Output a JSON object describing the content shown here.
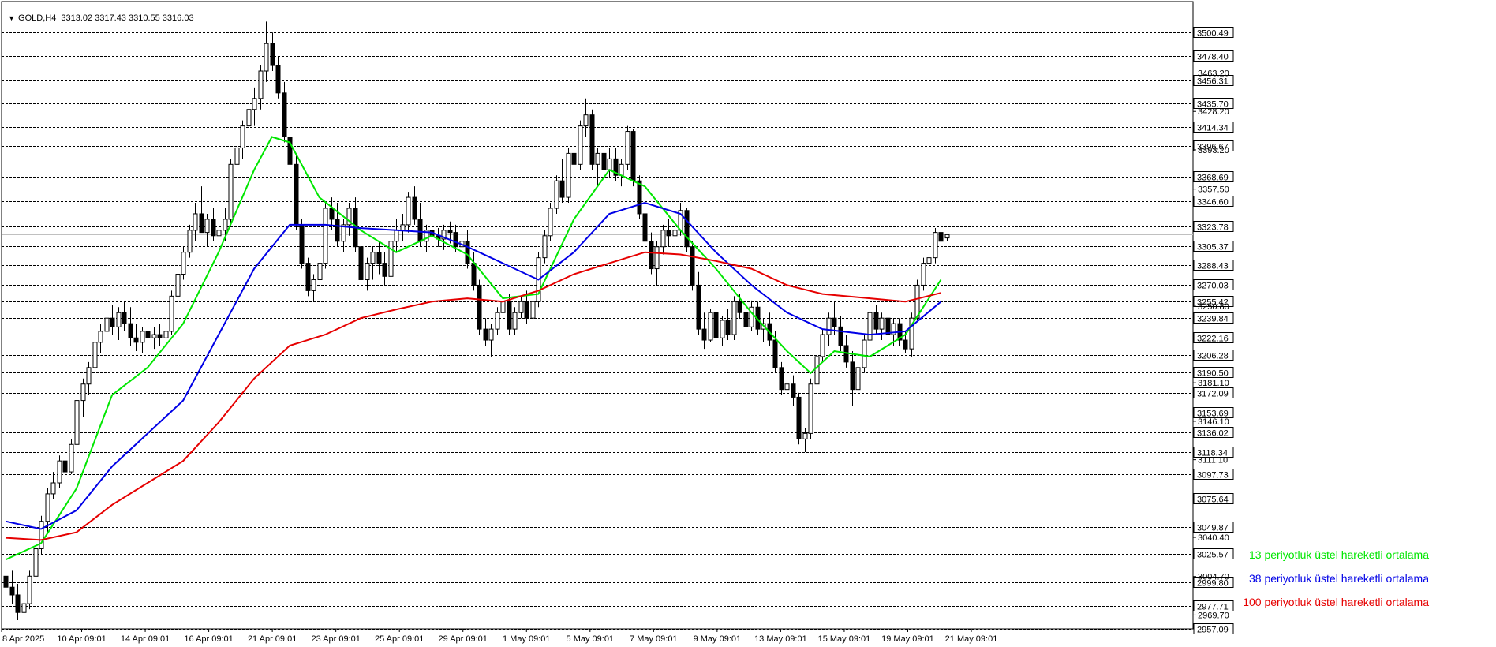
{
  "header": {
    "dropdown_icon": "triangle-down-icon",
    "symbol": "GOLD,H4",
    "ohlc": "3313.02 3317.43 3310.55 3316.03"
  },
  "legend": [
    {
      "label": "13 periyotluk üstel hareketli ortalama",
      "color": "#00e600"
    },
    {
      "label": "38 periyotluk üstel hareketli ortalama",
      "color": "#0000e6"
    },
    {
      "label": "100 periyotluk üstel hareketli ortalama",
      "color": "#e60000"
    }
  ],
  "chart_data": {
    "type": "candlestick",
    "symbol": "GOLD",
    "timeframe": "H4",
    "current_price": "3316.03",
    "ylim": [
      2957.09,
      3525
    ],
    "grid": "dashed horizontal",
    "x_labels": [
      "8 Apr 2025",
      "10 Apr 09:01",
      "14 Apr 09:01",
      "16 Apr 09:01",
      "21 Apr 09:01",
      "23 Apr 09:01",
      "25 Apr 09:01",
      "29 Apr 09:01",
      "1 May 09:01",
      "5 May 09:01",
      "7 May 09:01",
      "9 May 09:01",
      "13 May 09:01",
      "15 May 09:01",
      "19 May 09:01",
      "21 May 09:01"
    ],
    "y_labels_boxed": [
      "3500.49",
      "3478.40",
      "3456.31",
      "3435.70",
      "3414.34",
      "3396.67",
      "3368.69",
      "3346.60",
      "3323.78",
      "3305.37",
      "3288.43",
      "3270.03",
      "3255.42",
      "3239.84",
      "3222.16",
      "3206.28",
      "3190.50",
      "3172.09",
      "3153.69",
      "3136.02",
      "3118.34",
      "3097.73",
      "3075.64",
      "3049.87",
      "3025.57",
      "2999.80",
      "2977.71",
      "2957.09"
    ],
    "y_labels_plain": [
      "3463.20",
      "3428.20",
      "3393.20",
      "3357.50",
      "3323.78",
      "3288.43",
      "3250.80",
      "3222.16",
      "3181.10",
      "3146.10",
      "3111.10",
      "3075.64",
      "3040.40",
      "3004.70",
      "2969.70"
    ],
    "candles": [
      [
        3005,
        3012,
        2985,
        2995
      ],
      [
        2995,
        3010,
        2980,
        2988
      ],
      [
        2988,
        2998,
        2965,
        2972
      ],
      [
        2972,
        2985,
        2960,
        2980
      ],
      [
        2980,
        3010,
        2975,
        3005
      ],
      [
        3005,
        3035,
        3000,
        3030
      ],
      [
        3030,
        3060,
        3025,
        3055
      ],
      [
        3055,
        3085,
        3045,
        3080
      ],
      [
        3080,
        3100,
        3075,
        3090
      ],
      [
        3090,
        3115,
        3085,
        3110
      ],
      [
        3110,
        3125,
        3095,
        3100
      ],
      [
        3100,
        3130,
        3098,
        3125
      ],
      [
        3125,
        3170,
        3120,
        3165
      ],
      [
        3165,
        3185,
        3150,
        3180
      ],
      [
        3180,
        3200,
        3170,
        3195
      ],
      [
        3195,
        3222,
        3190,
        3218
      ],
      [
        3218,
        3235,
        3208,
        3228
      ],
      [
        3228,
        3248,
        3220,
        3240
      ],
      [
        3240,
        3252,
        3225,
        3232
      ],
      [
        3232,
        3250,
        3220,
        3245
      ],
      [
        3245,
        3255,
        3228,
        3235
      ],
      [
        3235,
        3250,
        3215,
        3222
      ],
      [
        3222,
        3235,
        3210,
        3218
      ],
      [
        3218,
        3232,
        3208,
        3228
      ],
      [
        3228,
        3240,
        3218,
        3222
      ],
      [
        3222,
        3232,
        3212,
        3225
      ],
      [
        3225,
        3235,
        3215,
        3222
      ],
      [
        3222,
        3238,
        3212,
        3228
      ],
      [
        3228,
        3265,
        3225,
        3260
      ],
      [
        3260,
        3285,
        3255,
        3280
      ],
      [
        3280,
        3305,
        3275,
        3300
      ],
      [
        3300,
        3325,
        3295,
        3320
      ],
      [
        3320,
        3345,
        3310,
        3335
      ],
      [
        3335,
        3360,
        3320,
        3318
      ],
      [
        3318,
        3335,
        3305,
        3330
      ],
      [
        3330,
        3340,
        3310,
        3315
      ],
      [
        3315,
        3330,
        3300,
        3320
      ],
      [
        3320,
        3340,
        3310,
        3330
      ],
      [
        3330,
        3385,
        3325,
        3380
      ],
      [
        3380,
        3400,
        3370,
        3395
      ],
      [
        3395,
        3420,
        3385,
        3415
      ],
      [
        3415,
        3435,
        3405,
        3430
      ],
      [
        3430,
        3450,
        3415,
        3440
      ],
      [
        3440,
        3470,
        3430,
        3465
      ],
      [
        3465,
        3510,
        3455,
        3490
      ],
      [
        3490,
        3500,
        3465,
        3470
      ],
      [
        3470,
        3478,
        3440,
        3445
      ],
      [
        3445,
        3455,
        3400,
        3405
      ],
      [
        3405,
        3410,
        3375,
        3380
      ],
      [
        3380,
        3390,
        3320,
        3325
      ],
      [
        3325,
        3330,
        3285,
        3290
      ],
      [
        3290,
        3295,
        3260,
        3265
      ],
      [
        3265,
        3280,
        3255,
        3275
      ],
      [
        3275,
        3295,
        3265,
        3290
      ],
      [
        3290,
        3345,
        3285,
        3340
      ],
      [
        3340,
        3350,
        3320,
        3330
      ],
      [
        3330,
        3345,
        3305,
        3310
      ],
      [
        3310,
        3330,
        3300,
        3325
      ],
      [
        3325,
        3345,
        3315,
        3340
      ],
      [
        3340,
        3350,
        3300,
        3305
      ],
      [
        3305,
        3315,
        3270,
        3275
      ],
      [
        3275,
        3295,
        3265,
        3290
      ],
      [
        3290,
        3305,
        3275,
        3300
      ],
      [
        3300,
        3310,
        3280,
        3290
      ],
      [
        3290,
        3300,
        3270,
        3278
      ],
      [
        3278,
        3315,
        3275,
        3310
      ],
      [
        3310,
        3330,
        3300,
        3320
      ],
      [
        3320,
        3335,
        3310,
        3325
      ],
      [
        3325,
        3355,
        3318,
        3350
      ],
      [
        3350,
        3360,
        3325,
        3330
      ],
      [
        3330,
        3345,
        3305,
        3310
      ],
      [
        3310,
        3325,
        3300,
        3320
      ],
      [
        3320,
        3330,
        3310,
        3315
      ],
      [
        3315,
        3322,
        3305,
        3312
      ],
      [
        3312,
        3325,
        3302,
        3320
      ],
      [
        3320,
        3328,
        3308,
        3318
      ],
      [
        3318,
        3325,
        3300,
        3305
      ],
      [
        3305,
        3318,
        3295,
        3310
      ],
      [
        3310,
        3320,
        3285,
        3290
      ],
      [
        3290,
        3300,
        3265,
        3270
      ],
      [
        3270,
        3275,
        3225,
        3230
      ],
      [
        3230,
        3240,
        3215,
        3220
      ],
      [
        3220,
        3235,
        3205,
        3230
      ],
      [
        3230,
        3250,
        3225,
        3245
      ],
      [
        3245,
        3260,
        3240,
        3255
      ],
      [
        3255,
        3262,
        3225,
        3230
      ],
      [
        3230,
        3250,
        3225,
        3245
      ],
      [
        3245,
        3260,
        3240,
        3255
      ],
      [
        3255,
        3265,
        3235,
        3240
      ],
      [
        3240,
        3260,
        3235,
        3255
      ],
      [
        3255,
        3300,
        3250,
        3295
      ],
      [
        3295,
        3320,
        3290,
        3315
      ],
      [
        3315,
        3345,
        3310,
        3340
      ],
      [
        3340,
        3370,
        3335,
        3365
      ],
      [
        3365,
        3385,
        3345,
        3350
      ],
      [
        3350,
        3395,
        3345,
        3390
      ],
      [
        3390,
        3400,
        3375,
        3380
      ],
      [
        3380,
        3420,
        3375,
        3415
      ],
      [
        3415,
        3440,
        3405,
        3425
      ],
      [
        3425,
        3430,
        3375,
        3380
      ],
      [
        3380,
        3395,
        3360,
        3390
      ],
      [
        3390,
        3400,
        3370,
        3375
      ],
      [
        3375,
        3395,
        3368,
        3385
      ],
      [
        3385,
        3395,
        3365,
        3370
      ],
      [
        3370,
        3385,
        3360,
        3380
      ],
      [
        3380,
        3415,
        3375,
        3410
      ],
      [
        3410,
        3412,
        3360,
        3365
      ],
      [
        3365,
        3370,
        3330,
        3335
      ],
      [
        3335,
        3345,
        3300,
        3310
      ],
      [
        3310,
        3318,
        3280,
        3285
      ],
      [
        3285,
        3310,
        3270,
        3305
      ],
      [
        3305,
        3325,
        3298,
        3320
      ],
      [
        3320,
        3330,
        3305,
        3315
      ],
      [
        3315,
        3325,
        3305,
        3320
      ],
      [
        3320,
        3345,
        3315,
        3338
      ],
      [
        3338,
        3340,
        3300,
        3305
      ],
      [
        3305,
        3310,
        3265,
        3270
      ],
      [
        3270,
        3282,
        3225,
        3230
      ],
      [
        3230,
        3245,
        3212,
        3220
      ],
      [
        3220,
        3248,
        3218,
        3245
      ],
      [
        3245,
        3250,
        3215,
        3222
      ],
      [
        3222,
        3242,
        3215,
        3238
      ],
      [
        3238,
        3248,
        3220,
        3225
      ],
      [
        3225,
        3260,
        3220,
        3255
      ],
      [
        3255,
        3262,
        3240,
        3245
      ],
      [
        3245,
        3252,
        3225,
        3232
      ],
      [
        3232,
        3256,
        3228,
        3250
      ],
      [
        3250,
        3255,
        3225,
        3230
      ],
      [
        3230,
        3240,
        3218,
        3235
      ],
      [
        3235,
        3245,
        3215,
        3220
      ],
      [
        3220,
        3228,
        3190,
        3195
      ],
      [
        3195,
        3200,
        3170,
        3175
      ],
      [
        3175,
        3185,
        3165,
        3180
      ],
      [
        3180,
        3188,
        3160,
        3168
      ],
      [
        3168,
        3172,
        3125,
        3130
      ],
      [
        3130,
        3140,
        3118,
        3135
      ],
      [
        3135,
        3185,
        3130,
        3180
      ],
      [
        3180,
        3210,
        3175,
        3205
      ],
      [
        3205,
        3230,
        3200,
        3225
      ],
      [
        3225,
        3245,
        3215,
        3240
      ],
      [
        3240,
        3255,
        3225,
        3232
      ],
      [
        3232,
        3242,
        3210,
        3215
      ],
      [
        3215,
        3225,
        3195,
        3200
      ],
      [
        3200,
        3210,
        3160,
        3175
      ],
      [
        3175,
        3200,
        3170,
        3195
      ],
      [
        3195,
        3225,
        3190,
        3220
      ],
      [
        3220,
        3250,
        3215,
        3245
      ],
      [
        3245,
        3252,
        3225,
        3230
      ],
      [
        3230,
        3245,
        3220,
        3240
      ],
      [
        3240,
        3248,
        3220,
        3225
      ],
      [
        3225,
        3240,
        3215,
        3235
      ],
      [
        3235,
        3240,
        3215,
        3220
      ],
      [
        3220,
        3228,
        3208,
        3212
      ],
      [
        3212,
        3245,
        3205,
        3240
      ],
      [
        3240,
        3275,
        3238,
        3270
      ],
      [
        3270,
        3295,
        3265,
        3290
      ],
      [
        3290,
        3300,
        3280,
        3295
      ],
      [
        3295,
        3322,
        3290,
        3318
      ],
      [
        3318,
        3325,
        3305,
        3310
      ],
      [
        3313,
        3317,
        3310,
        3316
      ]
    ],
    "series": [
      {
        "name": "13 periyotluk üstel hareketli ortalama",
        "color": "#00e600",
        "points": [
          [
            0,
            3020
          ],
          [
            6,
            3035
          ],
          [
            12,
            3085
          ],
          [
            18,
            3170
          ],
          [
            24,
            3195
          ],
          [
            30,
            3235
          ],
          [
            36,
            3300
          ],
          [
            42,
            3375
          ],
          [
            45,
            3405
          ],
          [
            48,
            3400
          ],
          [
            53,
            3350
          ],
          [
            60,
            3320
          ],
          [
            66,
            3300
          ],
          [
            72,
            3315
          ],
          [
            78,
            3298
          ],
          [
            84,
            3258
          ],
          [
            90,
            3262
          ],
          [
            96,
            3330
          ],
          [
            102,
            3375
          ],
          [
            108,
            3360
          ],
          [
            114,
            3320
          ],
          [
            120,
            3285
          ],
          [
            126,
            3245
          ],
          [
            132,
            3210
          ],
          [
            136,
            3190
          ],
          [
            140,
            3210
          ],
          [
            146,
            3205
          ],
          [
            152,
            3225
          ],
          [
            158,
            3275
          ]
        ]
      },
      {
        "name": "38 periyotluk üstel hareketli ortalama",
        "color": "#0000e6",
        "points": [
          [
            0,
            3055
          ],
          [
            6,
            3048
          ],
          [
            12,
            3065
          ],
          [
            18,
            3105
          ],
          [
            24,
            3135
          ],
          [
            30,
            3165
          ],
          [
            36,
            3225
          ],
          [
            42,
            3285
          ],
          [
            48,
            3325
          ],
          [
            54,
            3325
          ],
          [
            60,
            3322
          ],
          [
            66,
            3320
          ],
          [
            72,
            3318
          ],
          [
            78,
            3305
          ],
          [
            84,
            3290
          ],
          [
            90,
            3275
          ],
          [
            96,
            3300
          ],
          [
            102,
            3335
          ],
          [
            108,
            3345
          ],
          [
            114,
            3335
          ],
          [
            120,
            3300
          ],
          [
            126,
            3270
          ],
          [
            132,
            3245
          ],
          [
            138,
            3230
          ],
          [
            146,
            3225
          ],
          [
            152,
            3228
          ],
          [
            158,
            3255
          ]
        ]
      },
      {
        "name": "100 periyotluk üstel hareketli ortalama",
        "color": "#e60000",
        "points": [
          [
            0,
            3040
          ],
          [
            6,
            3038
          ],
          [
            12,
            3045
          ],
          [
            18,
            3070
          ],
          [
            24,
            3090
          ],
          [
            30,
            3110
          ],
          [
            36,
            3145
          ],
          [
            42,
            3185
          ],
          [
            48,
            3215
          ],
          [
            54,
            3225
          ],
          [
            60,
            3240
          ],
          [
            66,
            3248
          ],
          [
            72,
            3255
          ],
          [
            78,
            3258
          ],
          [
            84,
            3255
          ],
          [
            90,
            3265
          ],
          [
            96,
            3280
          ],
          [
            102,
            3290
          ],
          [
            108,
            3300
          ],
          [
            114,
            3298
          ],
          [
            120,
            3292
          ],
          [
            126,
            3285
          ],
          [
            132,
            3270
          ],
          [
            138,
            3262
          ],
          [
            146,
            3258
          ],
          [
            152,
            3255
          ],
          [
            158,
            3263
          ]
        ]
      }
    ]
  }
}
